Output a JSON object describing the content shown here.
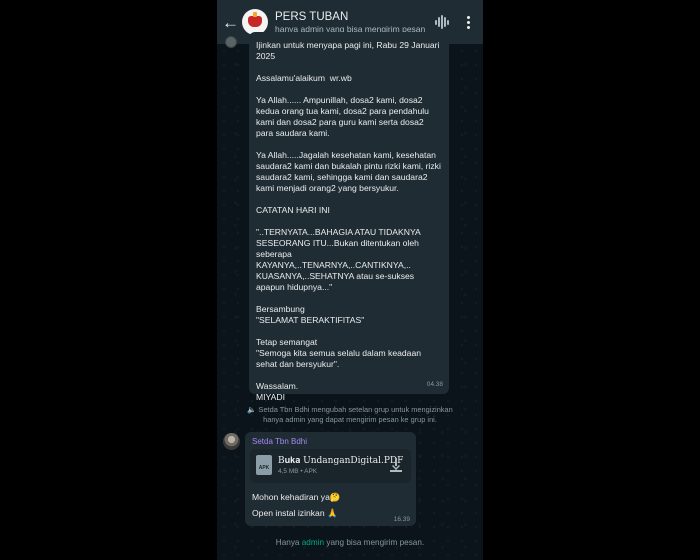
{
  "header": {
    "back_icon": "arrow-left-icon",
    "group_name": "PERS TUBAN",
    "subtitle": "hanya admin yang bisa mengirim pesan",
    "voice_icon": "voice-chat-icon",
    "menu_icon": "more-vertical-icon"
  },
  "message1": {
    "text": "Ijinkan untuk menyapa pagi ini, Rabu 29 Januari 2025\n\nAssalamu'alaikum  wr.wb\n\nYa Allah...... Ampunillah, dosa2 kami, dosa2 kedua orang tua kami, dosa2 para pendahulu kami dan dosa2 para guru kami serta dosa2 para saudara kami.\n\nYa Allah.....Jagalah kesehatan kami, kesehatan saudara2 kami dan bukalah pintu rizki kami, rizki saudara2 kami, sehingga kami dan saudara2 kami menjadi orang2 yang bersyukur.\n\nCATATAN HARI INI\n\n\"..TERNYATA...BAHAGIA ATAU TIDAKNYA SESEORANG ITU...Bukan ditentukan oleh seberapa KAYANYA,..TENARNYA,..CANTIKNYA,.. KUASANYA,..SEHATNYA atau se-sukses apapun hidupnya...\"\n\nBersambung\n\"SELAMAT BERAKTIFITAS\"\n\nTetap semangat\n\"Semoga kita semua selalu dalam keadaan sehat dan bersyukur\".\n\nWassalam.\nMIYADI",
    "time": "04.38"
  },
  "system_message": "Setda Tbn Bdhi mengubah setelan grup untuk mengizinkan hanya admin yang dapat mengirim pesan ke grup ini.",
  "message2": {
    "sender": "Setda Tbn Bdhi",
    "document": {
      "icon_label": "APK",
      "name": "B𝐮𝐤𝐚 UndanganDigital.PDF",
      "meta": "4,5 MB • APK",
      "download_icon": "download-icon"
    },
    "line1": "Mohon kehadiran ya🤔",
    "line2": "Open instal izinkan 🙏",
    "time": "16.39"
  },
  "footer": {
    "prefix": "Hanya",
    "admin": "admin",
    "suffix": "yang bisa mengirim pesan."
  }
}
